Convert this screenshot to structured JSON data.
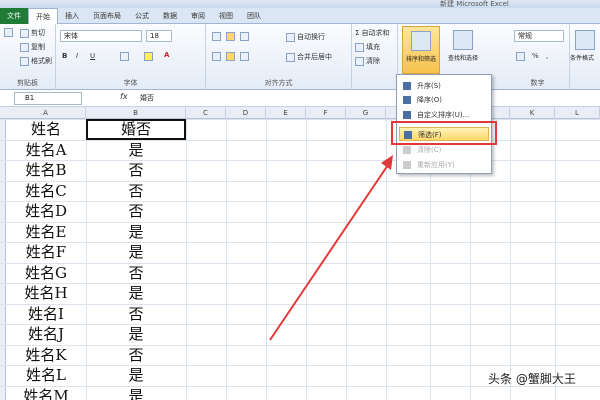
{
  "window": {
    "title": "新建 Microsoft Excel"
  },
  "tabs": [
    "开始",
    "插入",
    "页面布局",
    "公式",
    "数据",
    "审阅",
    "视图",
    "团队"
  ],
  "file_tab": "文件",
  "ribbon": {
    "clipboard": {
      "label": "剪贴板",
      "cut": "剪切",
      "copy": "复制",
      "paint": "格式刷"
    },
    "font": {
      "label": "字体",
      "name": "宋体",
      "size": "18"
    },
    "alignment": {
      "label": "对齐方式",
      "wrap": "自动换行",
      "merge": "合并后居中"
    },
    "editing": {
      "autosum": "自动求和",
      "fill": "填充",
      "clear": "清除",
      "sort_filter": "排序和筛选",
      "find_select": "查找和选择"
    },
    "number": {
      "label": "数字",
      "format": "常规"
    },
    "styles": {
      "cond": "条件格式"
    }
  },
  "formula_bar": {
    "name_box": "B1",
    "fx": "fx",
    "content": "婚否"
  },
  "columns": [
    "A",
    "B",
    "C",
    "D",
    "E",
    "F",
    "G",
    "H",
    "I",
    "J",
    "K",
    "L"
  ],
  "rows": [
    {
      "a": "姓名",
      "b": "婚否"
    },
    {
      "a": "姓名A",
      "b": "是"
    },
    {
      "a": "姓名B",
      "b": "否"
    },
    {
      "a": "姓名C",
      "b": "否"
    },
    {
      "a": "姓名D",
      "b": "否"
    },
    {
      "a": "姓名E",
      "b": "是"
    },
    {
      "a": "姓名F",
      "b": "是"
    },
    {
      "a": "姓名G",
      "b": "否"
    },
    {
      "a": "姓名H",
      "b": "是"
    },
    {
      "a": "姓名I",
      "b": "否"
    },
    {
      "a": "姓名J",
      "b": "是"
    },
    {
      "a": "姓名K",
      "b": "否"
    },
    {
      "a": "姓名L",
      "b": "是"
    },
    {
      "a": "姓名M",
      "b": "是"
    }
  ],
  "dropdown": {
    "items": [
      {
        "label": "升序(S)",
        "state": "normal"
      },
      {
        "label": "降序(O)",
        "state": "normal"
      },
      {
        "label": "自定义排序(U)...",
        "state": "normal"
      },
      {
        "label": "筛选(F)",
        "state": "highlighted"
      },
      {
        "label": "清除(C)",
        "state": "disabled"
      },
      {
        "label": "重新应用(Y)",
        "state": "disabled"
      }
    ]
  },
  "annotation": {
    "color": "#e23a3a"
  },
  "watermark": "头条 @蟹脚大王"
}
